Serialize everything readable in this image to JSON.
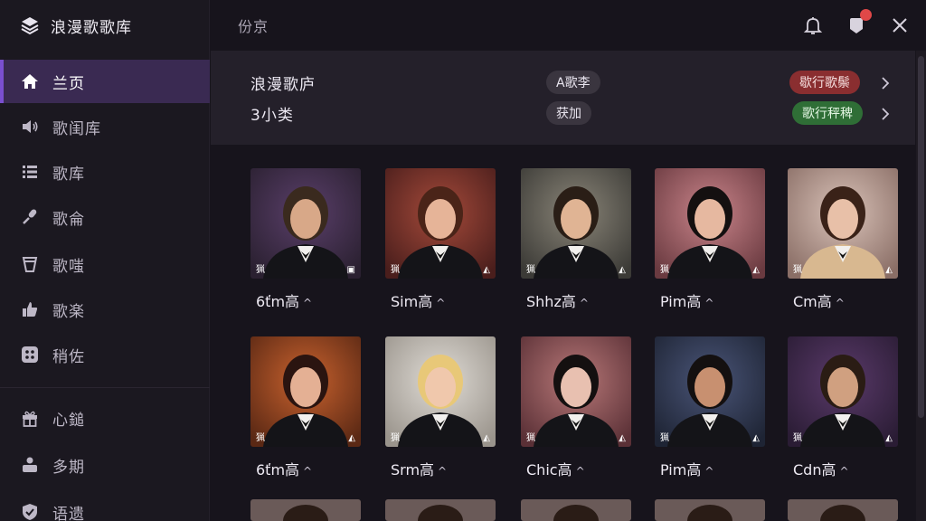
{
  "app": {
    "title": "浪漫歌歌库"
  },
  "topbar": {
    "breadcrumb": "份京"
  },
  "sidebar": {
    "items": [
      {
        "label": "兰页",
        "icon": "home-icon",
        "active": true
      },
      {
        "label": "歌闺库",
        "icon": "speaker-icon"
      },
      {
        "label": "歌库",
        "icon": "list-icon"
      },
      {
        "label": "歌侖",
        "icon": "microphone-icon"
      },
      {
        "label": "歌嗤",
        "icon": "cup-icon"
      },
      {
        "label": "歌楽",
        "icon": "thumbs-up-icon"
      },
      {
        "label": "稍佐",
        "icon": "grid-dots-icon"
      },
      {
        "label": "心鎚",
        "icon": "gift-icon"
      },
      {
        "label": "多期",
        "icon": "user-stack-icon"
      },
      {
        "label": "语遗",
        "icon": "shield-icon"
      }
    ]
  },
  "panel": {
    "row1": {
      "label": "浪漫歌庐",
      "pill": "A歌李",
      "action": "歇行歌鬃"
    },
    "row2": {
      "label": "3小类",
      "pill": "获加",
      "action": "歌行秤稗"
    }
  },
  "colors": {
    "accent": "#7a4fd0",
    "red_pill": "#8a2e30",
    "green_pill": "#2f6e36",
    "badge": "#e04848"
  },
  "cards": [
    {
      "name": "6ťm高",
      "tag_l": "猟",
      "tag_r": "▣"
    },
    {
      "name": "Sim高",
      "tag_l": "猟",
      "tag_r": "◭"
    },
    {
      "name": "Shhz高",
      "tag_l": "猟",
      "tag_r": "◭"
    },
    {
      "name": "Pim高",
      "tag_l": "猟",
      "tag_r": "◭"
    },
    {
      "name": "Cm高",
      "tag_l": "猟",
      "tag_r": "◭"
    },
    {
      "name": "6ťm高",
      "tag_l": "猟",
      "tag_r": "◭"
    },
    {
      "name": "Srm高",
      "tag_l": "猟",
      "tag_r": "◭"
    },
    {
      "name": "Chic高",
      "tag_l": "猟",
      "tag_r": "◭"
    },
    {
      "name": "Pim高",
      "tag_l": "猟",
      "tag_r": "◭"
    },
    {
      "name": "Cdn高",
      "tag_l": "猟",
      "tag_r": "◭"
    }
  ]
}
